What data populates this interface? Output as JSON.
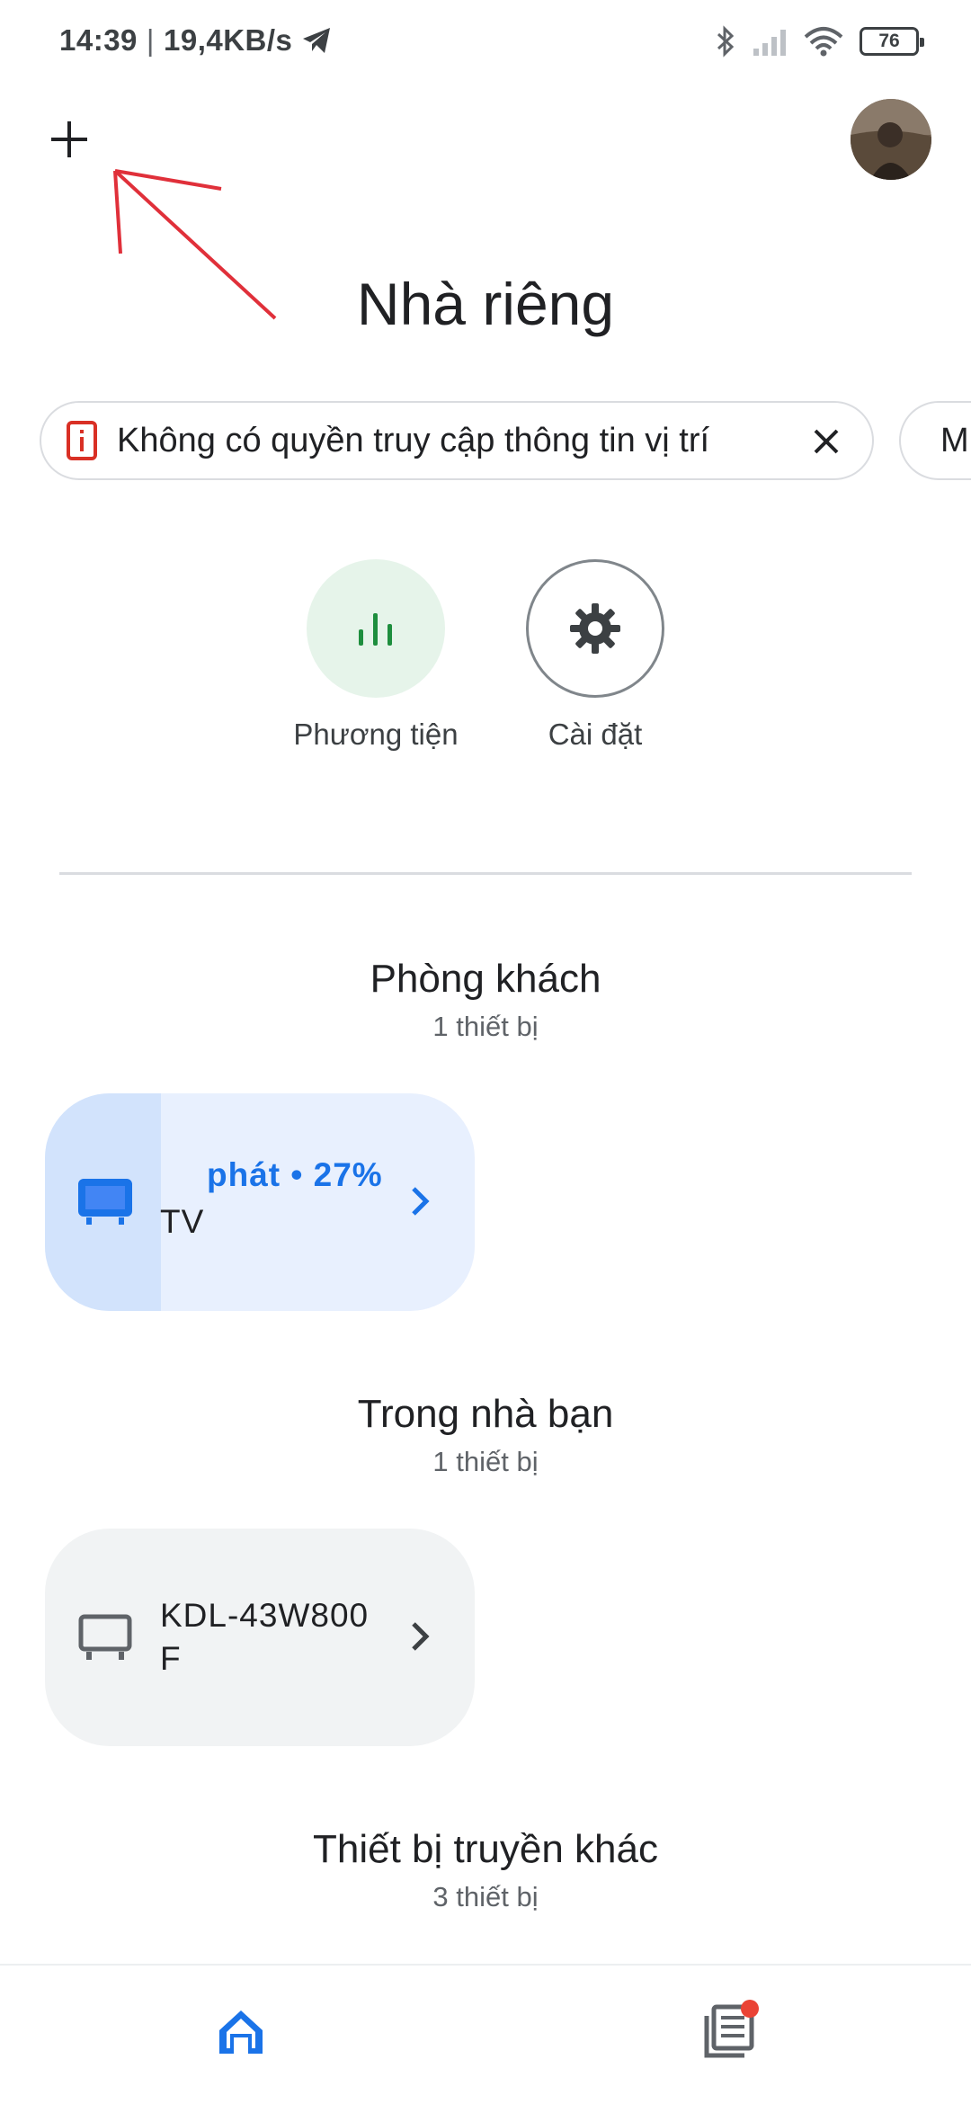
{
  "status_bar": {
    "time": "14:39",
    "separator": "|",
    "network_speed": "19,4KB/s",
    "battery_level": "76",
    "icons": [
      "telegram-icon",
      "bluetooth-icon",
      "signal-icon",
      "wifi-icon",
      "battery-icon"
    ]
  },
  "header": {
    "add_icon": "plus-icon",
    "avatar_icon": "account-avatar",
    "title": "Nhà riêng"
  },
  "chips": {
    "location_text": "Không có quyền truy cập thông tin vị trí",
    "location_icon": "info-phone-icon",
    "close_icon": "close-icon",
    "next_chip_text": "M"
  },
  "quick_actions": {
    "media": {
      "label": "Phương tiện",
      "icon": "media-bars-icon",
      "color": "#e6f4ea",
      "icon_color": "#1e8e3e"
    },
    "settings": {
      "label": "Cài đặt",
      "icon": "gear-icon"
    }
  },
  "rooms": [
    {
      "title": "Phòng khách",
      "count": "1 thiết bị",
      "device": {
        "status": "phát • 27%",
        "name": "TV",
        "icon": "tv-icon",
        "progress": 0.27,
        "active": true
      }
    },
    {
      "title": "Trong nhà bạn",
      "count": "1 thiết bị",
      "device": {
        "name_line1": "KDL-43W800",
        "name_line2": "F",
        "icon": "tv-icon",
        "active": false
      }
    },
    {
      "title": "Thiết bị truyền khác",
      "count": "3 thiết bị"
    }
  ],
  "bottom_nav": {
    "home_icon": "home-icon",
    "feed_icon": "feed-icon",
    "accent": "#1a73e8",
    "badge_color": "#ea4335"
  }
}
